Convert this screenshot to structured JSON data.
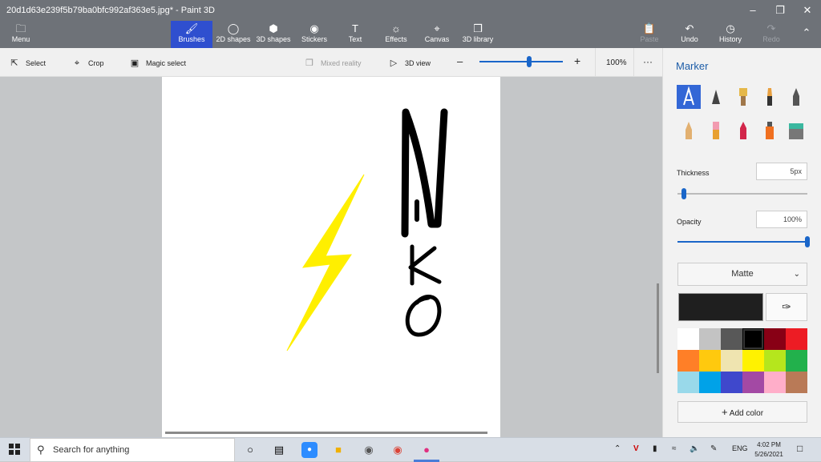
{
  "window": {
    "title": "20d1d63e239f5b79ba0bfc992af363e5.jpg* - Paint 3D"
  },
  "ribbon": {
    "menu": "Menu",
    "tabs": [
      "Brushes",
      "2D shapes",
      "3D shapes",
      "Stickers",
      "Text",
      "Effects",
      "Canvas",
      "3D library"
    ],
    "active_tab": "Brushes",
    "paste": "Paste",
    "undo": "Undo",
    "history": "History",
    "redo": "Redo"
  },
  "toolbar": {
    "select": "Select",
    "crop": "Crop",
    "magic_select": "Magic select",
    "mixed_reality": "Mixed reality",
    "view_3d": "3D view",
    "zoom": "100%",
    "zoom_level": 0.6,
    "more": "···"
  },
  "canvas": {
    "letters": [
      "N",
      "I",
      "K",
      "O"
    ],
    "bolt_color": "#ffef00"
  },
  "panel": {
    "title": "Marker",
    "thickness_label": "Thickness",
    "thickness_value": "5px",
    "thickness_fraction": 0.05,
    "opacity_label": "Opacity",
    "opacity_value": "100%",
    "opacity_fraction": 1.0,
    "finish": "Matte",
    "selected_color": "#1f1f1f",
    "palette": [
      "#ffffff",
      "#c3c3c3",
      "#585858",
      "#000000",
      "#880015",
      "#ed1c24",
      "#ff7f27",
      "#ffc90e",
      "#efe4b0",
      "#fff200",
      "#b5e61d",
      "#22b14c",
      "#99d9ea",
      "#00a2e8",
      "#3f48cc",
      "#a349a4",
      "#ffaec9",
      "#b97a57"
    ],
    "add_color": "Add color"
  },
  "taskbar": {
    "search_placeholder": "Search for anything",
    "lang": "ENG",
    "time": "4:02 PM",
    "date": "5/26/2021"
  }
}
